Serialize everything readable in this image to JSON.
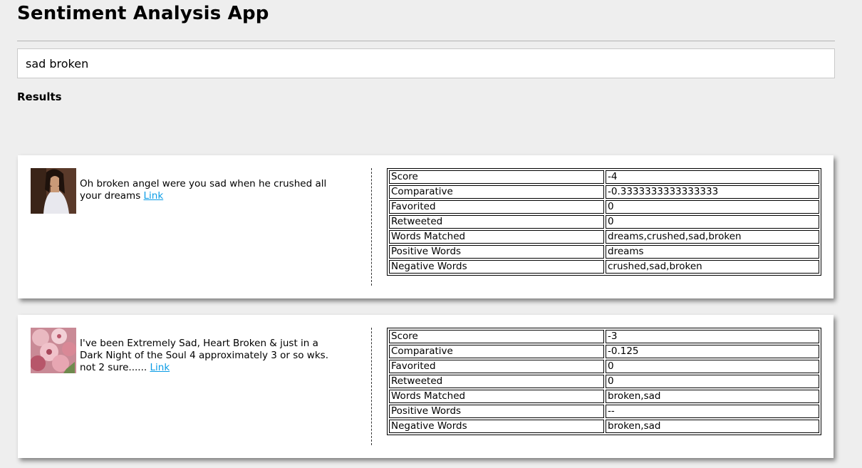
{
  "app": {
    "title": "Sentiment Analysis App"
  },
  "search": {
    "value": "sad broken"
  },
  "results": {
    "heading": "Results",
    "link_label": "Link",
    "tweets": [
      {
        "text": "Oh broken angel were you sad when he crushed all your dreams",
        "score": "-4",
        "comparative": "-0.3333333333333333",
        "favorited": "0",
        "retweeted": "0",
        "words_matched": "dreams,crushed,sad,broken",
        "positive_words": "dreams",
        "negative_words": "crushed,sad,broken"
      },
      {
        "text": "I've been Extremely Sad, Heart Broken & just in a Dark Night of the Soul 4 approximately 3 or so wks. not 2 sure......",
        "score": "-3",
        "comparative": "-0.125",
        "favorited": "0",
        "retweeted": "0",
        "words_matched": "broken,sad",
        "positive_words": "--",
        "negative_words": "broken,sad"
      }
    ]
  },
  "labels": {
    "score": "Score",
    "comparative": "Comparative",
    "favorited": "Favorited",
    "retweeted": "Retweeted",
    "words_matched": "Words Matched",
    "positive_words": "Positive Words",
    "negative_words": "Negative Words"
  },
  "colors": {
    "link": "#0a9ce6",
    "background": "#eeeeee",
    "card": "#ffffff"
  }
}
